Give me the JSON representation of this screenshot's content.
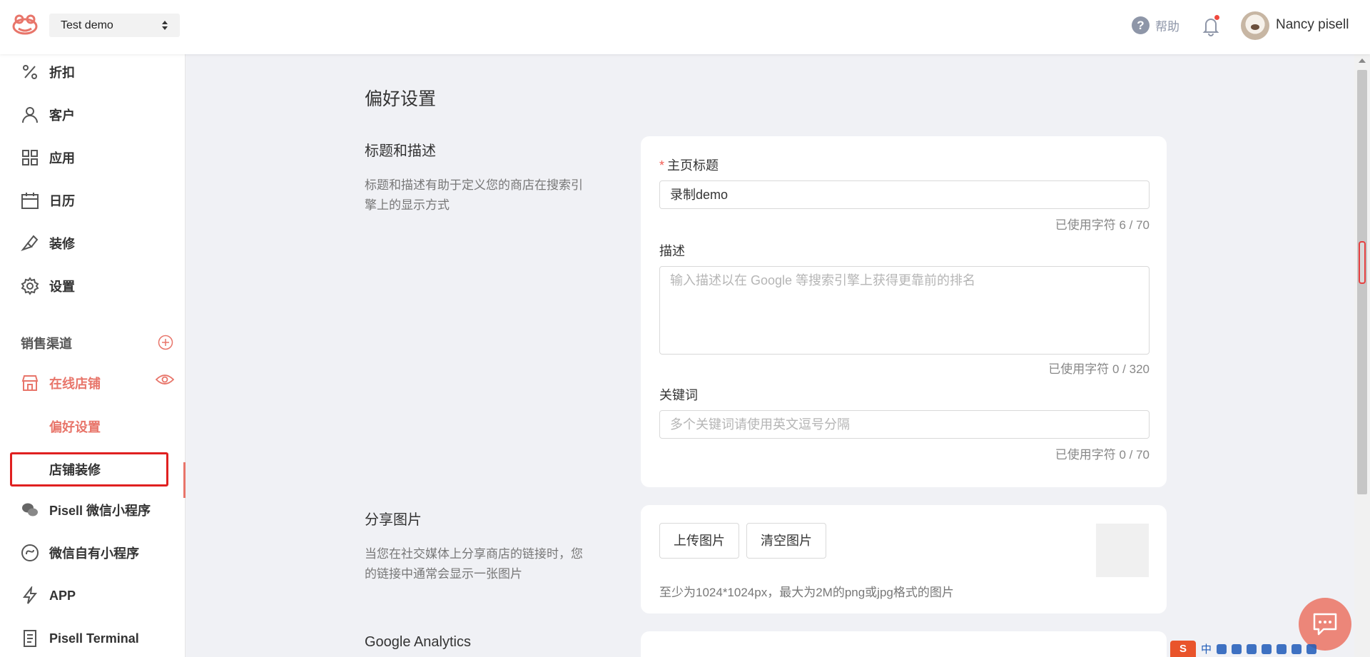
{
  "header": {
    "store_name": "Test demo",
    "help_label": "帮助",
    "username": "Nancy pisell"
  },
  "sidebar": {
    "items": [
      {
        "label": "折扣",
        "icon": "percent-icon"
      },
      {
        "label": "客户",
        "icon": "user-icon"
      },
      {
        "label": "应用",
        "icon": "apps-grid-icon"
      },
      {
        "label": "日历",
        "icon": "calendar-icon"
      },
      {
        "label": "装修",
        "icon": "brush-icon"
      },
      {
        "label": "设置",
        "icon": "gear-icon"
      }
    ],
    "sales_channels_title": "销售渠道",
    "online_store": "在线店铺",
    "sub_items": [
      "偏好设置",
      "店铺装修"
    ],
    "channels": [
      {
        "label": "Pisell 微信小程序",
        "icon": "wechat-icon"
      },
      {
        "label": "微信自有小程序",
        "icon": "mini-program-icon"
      },
      {
        "label": "APP",
        "icon": "lightning-icon"
      },
      {
        "label": "Pisell Terminal",
        "icon": "terminal-icon"
      }
    ]
  },
  "main": {
    "page_title": "偏好设置",
    "title_section": {
      "title": "标题和描述",
      "desc": "标题和描述有助于定义您的商店在搜索引擎上的显示方式",
      "homepage_title_label": "主页标题",
      "homepage_title_value": "录制demo",
      "homepage_title_counter": "已使用字符 6 / 70",
      "description_label": "描述",
      "description_placeholder": "输入描述以在 Google 等搜索引擎上获得更靠前的排名",
      "description_counter": "已使用字符 0 / 320",
      "keywords_label": "关键词",
      "keywords_placeholder": "多个关键词请使用英文逗号分隔",
      "keywords_counter": "已使用字符 0 / 70"
    },
    "share_section": {
      "title": "分享图片",
      "desc": "当您在社交媒体上分享商店的链接时，您的链接中通常会显示一张图片",
      "upload_button": "上传图片",
      "clear_button": "清空图片",
      "hint": "至少为1024*1024px，最大为2M的png或jpg格式的图片"
    },
    "analytics_section": {
      "title": "Google Analytics"
    }
  },
  "tray": {
    "ime": "中"
  },
  "colors": {
    "accent": "#e8756a",
    "highlight_border": "#e02020",
    "chat_bubble": "#ec8679"
  }
}
